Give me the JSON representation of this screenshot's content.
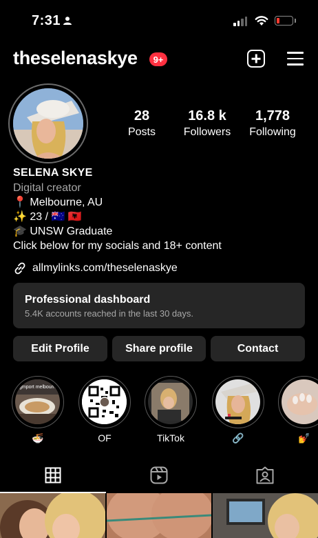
{
  "status_bar": {
    "time": "7:31",
    "battery_percent": 20,
    "battery_color": "#ff3b30"
  },
  "header": {
    "username": "theselenaskye",
    "notification_badge": "9+"
  },
  "stats": {
    "posts": {
      "value": "28",
      "label": "Posts"
    },
    "followers": {
      "value": "16.8 k",
      "label": "Followers"
    },
    "following": {
      "value": "1,778",
      "label": "Following"
    }
  },
  "bio": {
    "name": "SELENA SKYE",
    "category": "Digital creator",
    "lines": [
      "📍 Melbourne, AU",
      "✨ 23 / 🇦🇺 🇦🇱",
      "🎓 UNSW Graduate",
      "Click below for my socials and 18+ content"
    ],
    "link": "allmylinks.com/theselenaskye"
  },
  "dashboard": {
    "title": "Professional dashboard",
    "subtitle": "5.4K accounts reached in the last 30 days."
  },
  "buttons": {
    "edit": "Edit Profile",
    "share": "Share profile",
    "contact": "Contact"
  },
  "highlights": [
    {
      "label": "🍜",
      "thumb_text": "gmport melbourn"
    },
    {
      "label": "OF"
    },
    {
      "label": "TikTok"
    },
    {
      "label": "🔗"
    },
    {
      "label": "💅"
    }
  ],
  "tabs": [
    "grid-icon",
    "reels-icon",
    "tagged-icon"
  ],
  "colors": {
    "background": "#000000",
    "surface": "#262626",
    "muted_text": "#a8a8a8",
    "badge": "#ff3040"
  }
}
